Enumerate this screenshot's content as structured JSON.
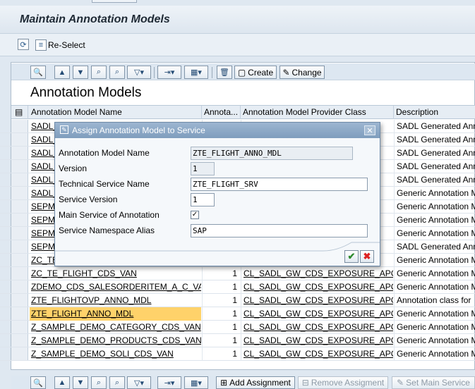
{
  "window": {
    "title": "Maintain Annotation Models",
    "reselect_label": "Re-Select"
  },
  "grid": {
    "title": "Annotation Models",
    "toolbar": {
      "create_label": "Create",
      "change_label": "Change"
    },
    "columns": [
      "Annotation Model Name",
      "Annota...",
      "Annotation Model Provider Class",
      "Description"
    ],
    "rows": [
      {
        "name": "SADL_",
        "count": "",
        "cls": "C",
        "desc": "SADL Generated Ann"
      },
      {
        "name": "SADL_",
        "count": "",
        "cls": "C",
        "desc": "SADL Generated Ann"
      },
      {
        "name": "SADL_",
        "count": "",
        "cls": "C",
        "desc": "SADL Generated Ann"
      },
      {
        "name": "SADL_",
        "count": "",
        "cls": "C",
        "desc": "SADL Generated Ann"
      },
      {
        "name": "SADL_",
        "count": "",
        "cls": "C",
        "desc": "SADL Generated Ann"
      },
      {
        "name": "SADL_",
        "count": "",
        "cls": "C",
        "desc": "Generic Annotation M"
      },
      {
        "name": "SEPMF",
        "count": "",
        "cls": "C",
        "desc": "Generic Annotation M"
      },
      {
        "name": "SEPMF",
        "count": "",
        "cls": "C",
        "desc": "Generic Annotation M"
      },
      {
        "name": "SEPMF",
        "count": "",
        "cls": "C",
        "desc": "Generic Annotation M"
      },
      {
        "name": "SEPMF",
        "count": "",
        "cls": "C",
        "desc": "SADL Generated Ann"
      },
      {
        "name": "ZC_TE",
        "count": "",
        "cls": "C",
        "desc": "Generic Annotation M"
      },
      {
        "name": "ZC_TE_FLIGHT_CDS_VAN",
        "count": "1",
        "cls": "CL_SADL_GW_CDS_EXPOSURE_APC",
        "desc": "Generic Annotation M"
      },
      {
        "name": "ZDEMO_CDS_SALESORDERITEM_A_C_VAN",
        "count": "1",
        "cls": "CL_SADL_GW_CDS_EXPOSURE_APC",
        "desc": "Generic Annotation M"
      },
      {
        "name": "ZTE_FLIGHTOVP_ANNO_MDL",
        "count": "1",
        "cls": "CL_SADL_GW_CDS_EXPOSURE_APC",
        "desc": "Annotation class for"
      },
      {
        "name": "ZTE_FLIGHT_ANNO_MDL",
        "count": "1",
        "cls": "CL_SADL_GW_CDS_EXPOSURE_APC",
        "desc": "Generic Annotation M"
      },
      {
        "name": "Z_SAMPLE_DEMO_CATEGORY_CDS_VAN",
        "count": "1",
        "cls": "CL_SADL_GW_CDS_EXPOSURE_APC",
        "desc": "Generic Annotation M"
      },
      {
        "name": "Z_SAMPLE_DEMO_PRODUCTS_CDS_VAN",
        "count": "1",
        "cls": "CL_SADL_GW_CDS_EXPOSURE_APC",
        "desc": "Generic Annotation M"
      },
      {
        "name": "Z_SAMPLE_DEMO_SOLI_CDS_VAN",
        "count": "1",
        "cls": "CL_SADL_GW_CDS_EXPOSURE_APC",
        "desc": "Generic Annotation M"
      }
    ],
    "selected_row": 14
  },
  "bottom_toolbar": {
    "add_label": "Add Assignment",
    "remove_label": "Remove Assigment",
    "setmain_label": "Set Main Service"
  },
  "dialog": {
    "title": "Assign Annotation Model to Service",
    "fields": {
      "model_name_label": "Annotation Model Name",
      "model_name_value": "ZTE_FLIGHT_ANNO_MDL",
      "version_label": "Version",
      "version_value": "1",
      "tech_service_label": "Technical Service Name",
      "tech_service_value": "ZTE_FLIGHT_SRV",
      "service_version_label": "Service Version",
      "service_version_value": "1",
      "main_service_label": "Main Service of Annotation",
      "main_service_checked": "✓",
      "alias_label": "Service Namespace Alias",
      "alias_value": "SAP"
    }
  }
}
